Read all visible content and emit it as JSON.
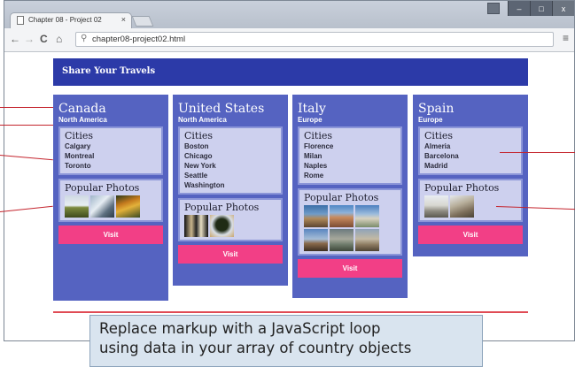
{
  "browser": {
    "tab_title": "Chapter 08 - Project 02",
    "tab_close": "×",
    "url": "chapter08-project02.html",
    "back": "←",
    "forward": "→",
    "reload": "C",
    "home": "⌂",
    "search_icon": "⚲",
    "menu_icon": "≡",
    "minimize": "–",
    "maximize": "□",
    "close": "x"
  },
  "page": {
    "header_title": "Share Your Travels",
    "cities_heading": "Cities",
    "photos_heading": "Popular Photos",
    "visit_label": "Visit",
    "countries": [
      {
        "name": "Canada",
        "continent": "North America",
        "cities": [
          "Calgary",
          "Montreal",
          "Toronto"
        ],
        "photos": [
          "field-photo",
          "winter-trees-photo",
          "autumn-forest-photo"
        ]
      },
      {
        "name": "United States",
        "continent": "North America",
        "cities": [
          "Boston",
          "Chicago",
          "New York",
          "Seattle",
          "Washington"
        ],
        "photos": [
          "city-night-photo",
          "tree-photo"
        ]
      },
      {
        "name": "Italy",
        "continent": "Europe",
        "cities": [
          "Florence",
          "Milan",
          "Naples",
          "Rome"
        ],
        "photos": [
          "coast-photo",
          "cathedral-photo",
          "tower-photo",
          "square-photo",
          "bridge-photo",
          "ruins-photo"
        ]
      },
      {
        "name": "Spain",
        "continent": "Europe",
        "cities": [
          "Almeria",
          "Barcelona",
          "Madrid"
        ],
        "photos": [
          "palace-photo",
          "church-photo"
        ]
      }
    ]
  },
  "caption": {
    "line1": "Replace markup with a JavaScript loop",
    "line2": "using data in your array of country objects"
  },
  "colors": {
    "header": "#2c3aa8",
    "card": "#5563c1",
    "box": "#cdd0ee",
    "visit_button": "#f23f86",
    "annotation": "#c4242d"
  }
}
